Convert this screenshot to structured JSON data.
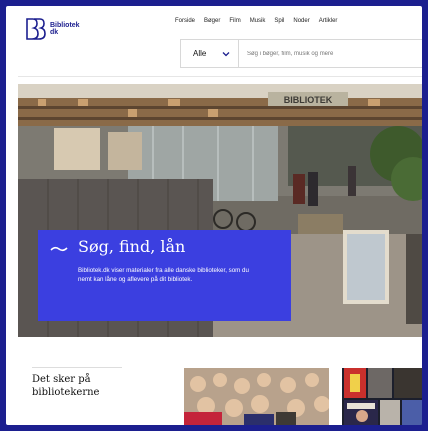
{
  "brand": {
    "logo_line1": "Bibliotek",
    "logo_line2": "dk",
    "color": "#1c1f8f"
  },
  "nav": {
    "items": [
      "Forside",
      "Bøger",
      "Film",
      "Musik",
      "Spil",
      "Noder",
      "Artikler"
    ]
  },
  "search": {
    "category": "Alle",
    "placeholder": "Søg i bøger, film, musik og mere"
  },
  "hero": {
    "title": "Søg, find, lån",
    "body": "Bibliotek.dk viser materialer fra alle danske biblioteker, som du nemt kan låne og aflevere på dit bibliotek.",
    "card_color": "#3b3fe0",
    "sign_text": "BIBLIOTEK"
  },
  "events": {
    "title": "Det sker på bibliotekerne"
  }
}
